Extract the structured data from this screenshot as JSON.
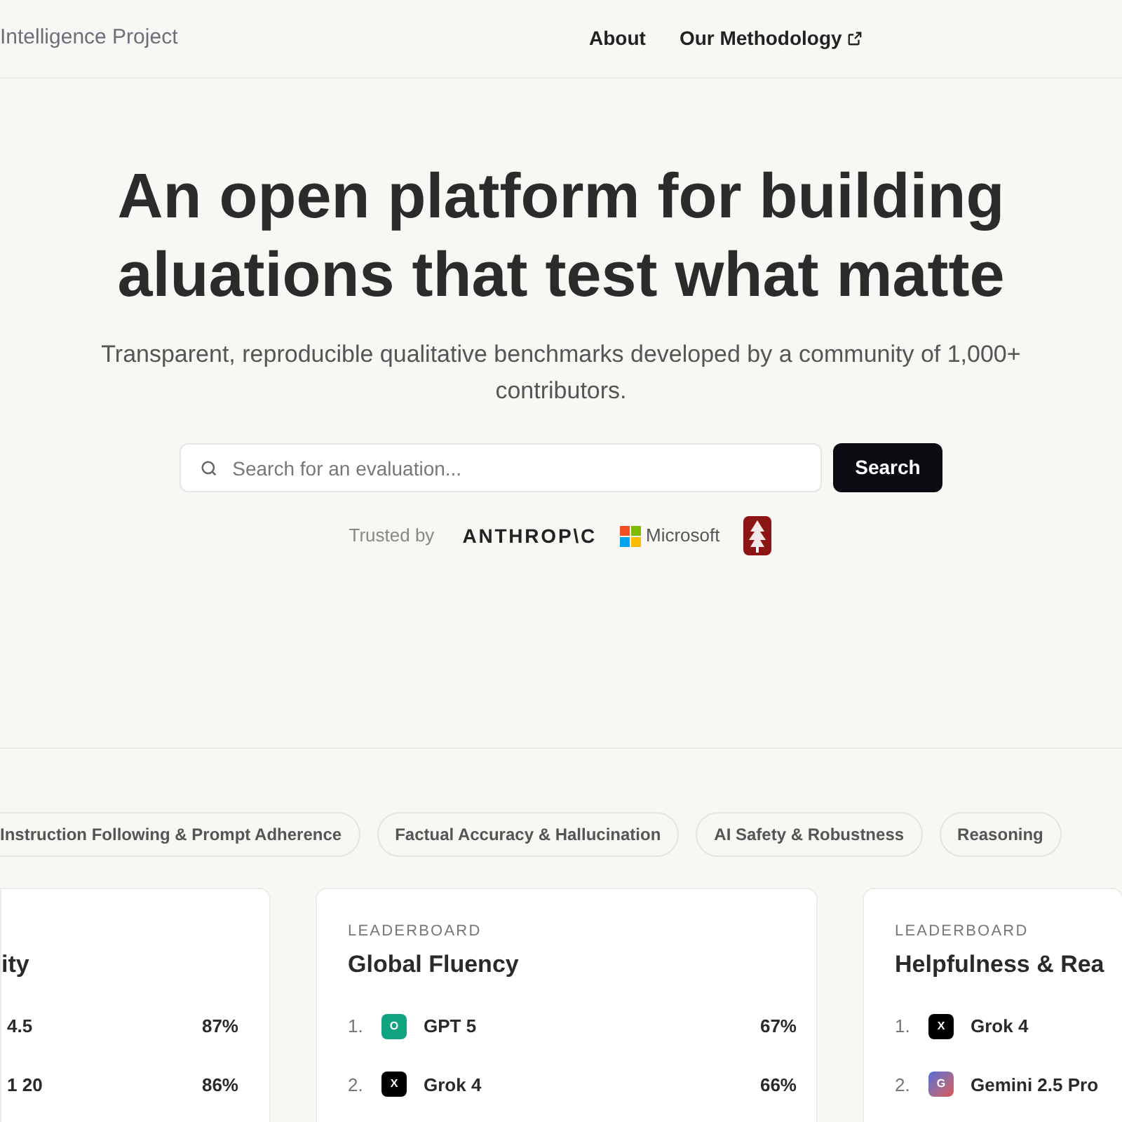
{
  "header": {
    "brand": "Intelligence Project",
    "nav": [
      {
        "label": "About",
        "external": false
      },
      {
        "label": "Our Methodology",
        "external": true
      }
    ]
  },
  "hero": {
    "headline": [
      "An open platform for building",
      "aluations that test what matte"
    ],
    "subtitle": "Transparent, reproducible qualitative benchmarks developed by a community of 1,000+ contributors.",
    "search": {
      "placeholder": "Search for an evaluation...",
      "button": "Search"
    },
    "trusted_label": "Trusted by",
    "logos": [
      {
        "kind": "anthropic",
        "text": "ANTHROP\\C"
      },
      {
        "kind": "microsoft",
        "text": "Microsoft"
      },
      {
        "kind": "stanford"
      }
    ]
  },
  "categories": [
    {
      "label": "Instruction Following & Prompt Adherence"
    },
    {
      "label": "Factual Accuracy & Hallucination"
    },
    {
      "label": "AI Safety & Robustness"
    },
    {
      "label": "Reasoning"
    }
  ],
  "leaderboards": [
    {
      "title": "ity",
      "rows": [
        {
          "model": "4.5",
          "score": "87%"
        },
        {
          "model": "1 20",
          "score": "86%"
        }
      ]
    },
    {
      "eyebrow": "LEADERBOARD",
      "title": "Global Fluency",
      "rows": [
        {
          "rank": "1.",
          "model": "GPT 5",
          "badge": {
            "kind": "openai",
            "text": "O"
          },
          "score": "67%"
        },
        {
          "rank": "2.",
          "model": "Grok 4",
          "badge": {
            "kind": "xai",
            "text": "X"
          },
          "score": "66%"
        }
      ]
    },
    {
      "eyebrow": "LEADERBOARD",
      "title": "Helpfulness & Rea",
      "rows": [
        {
          "rank": "1.",
          "model": "Grok 4",
          "badge": {
            "kind": "xai",
            "text": "X"
          }
        },
        {
          "rank": "2.",
          "model": "Gemini 2.5 Pro",
          "badge": {
            "kind": "gemini",
            "text": "G"
          }
        }
      ]
    }
  ]
}
